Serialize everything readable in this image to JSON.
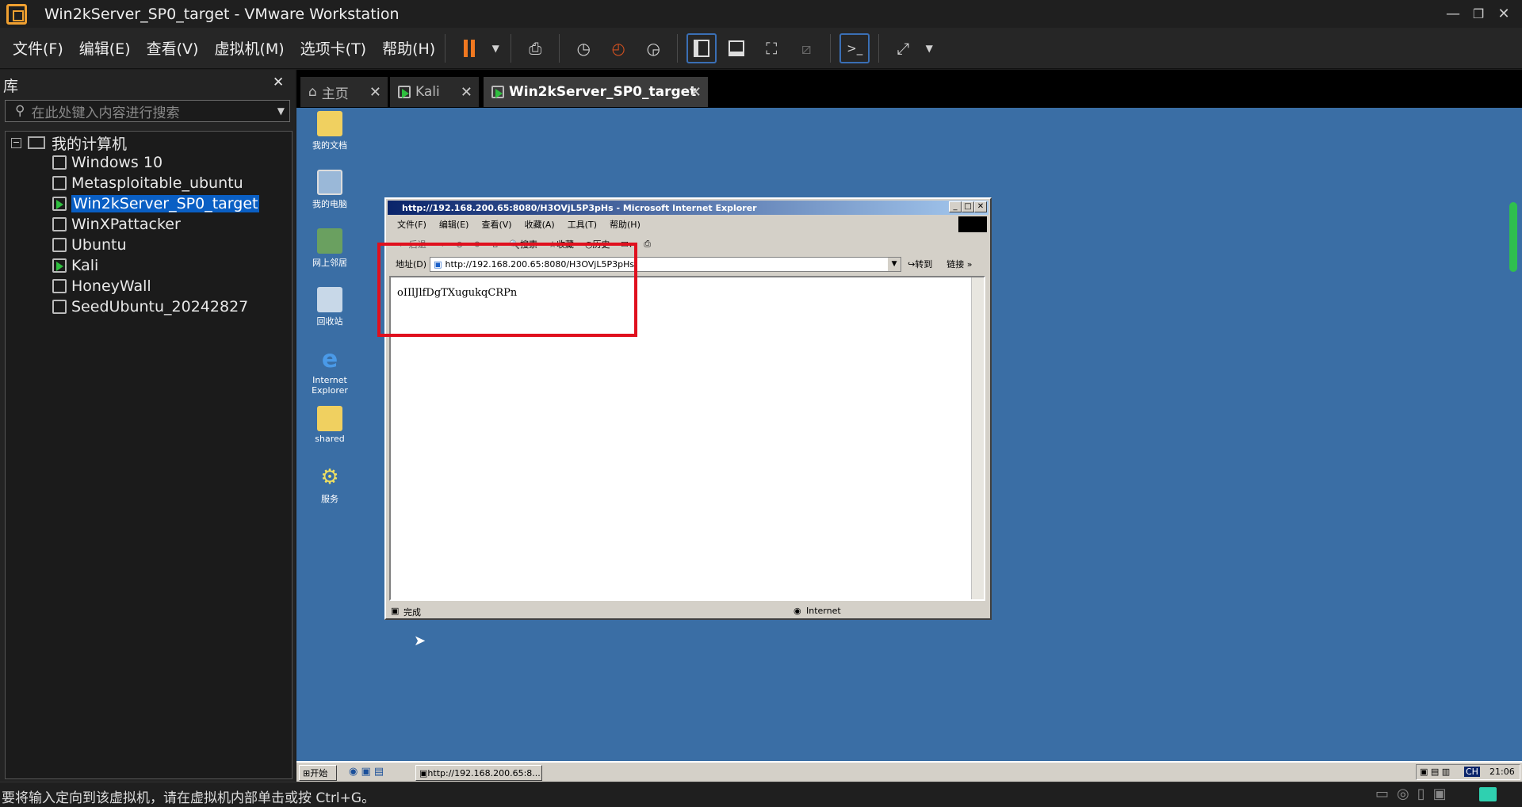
{
  "window": {
    "title": "Win2kServer_SP0_target - VMware Workstation",
    "min": "—",
    "restore": "❐",
    "close": "✕"
  },
  "menu": [
    "文件(F)",
    "编辑(E)",
    "查看(V)",
    "虚拟机(M)",
    "选项卡(T)",
    "帮助(H)"
  ],
  "toolbar_icons": [
    "pause-icon",
    "send-ctrl-alt-del-icon",
    "snapshot-icon",
    "revert-snapshot-icon",
    "snapshot-manager-icon",
    "library-view-icon",
    "thumbnail-view-icon",
    "fullscreen-icon",
    "unity-icon",
    "console-icon",
    "stretch-icon"
  ],
  "library": {
    "title": "库",
    "close": "✕",
    "search_placeholder": "在此处键入内容进行搜索",
    "root": "我的计算机",
    "vms": [
      {
        "name": "Windows 10",
        "running": false
      },
      {
        "name": "Metasploitable_ubuntu",
        "running": false
      },
      {
        "name": "Win2kServer_SP0_target",
        "running": true,
        "selected": true
      },
      {
        "name": "WinXPattacker",
        "running": false
      },
      {
        "name": "Ubuntu",
        "running": false
      },
      {
        "name": "Kali",
        "running": true
      },
      {
        "name": "HoneyWall",
        "running": false
      },
      {
        "name": "SeedUbuntu_20242827",
        "running": false
      }
    ]
  },
  "tabs": [
    {
      "label": "主页"
    },
    {
      "label": "Kali"
    },
    {
      "label": "Win2kServer_SP0_target",
      "active": true
    }
  ],
  "desktop_icons": [
    "我的文档",
    "我的电脑",
    "网上邻居",
    "回收站",
    "Internet Explorer",
    "shared",
    "服务"
  ],
  "ie": {
    "title": "http://192.168.200.65:8080/H3OVjL5P3pHs - Microsoft Internet Explorer",
    "menu": [
      "文件(F)",
      "编辑(E)",
      "查看(V)",
      "收藏(A)",
      "工具(T)",
      "帮助(H)"
    ],
    "toolbar": {
      "back": "后退",
      "search": "搜索",
      "favorites": "收藏",
      "history": "历史"
    },
    "address_label": "地址(D)",
    "url": "http://192.168.200.65:8080/H3OVjL5P3pHs",
    "go": "转到",
    "links": "链接",
    "body_text": "oIIlJlfDgTXugukqCRPn",
    "status": "完成",
    "zone": "Internet"
  },
  "taskbar": {
    "start": "开始",
    "task": "http://192.168.200.65:8...",
    "time": "21:06",
    "lang": "CH"
  },
  "statusbar": {
    "text": "要将输入定向到该虚拟机，请在虚拟机内部单击或按 Ctrl+G。"
  }
}
